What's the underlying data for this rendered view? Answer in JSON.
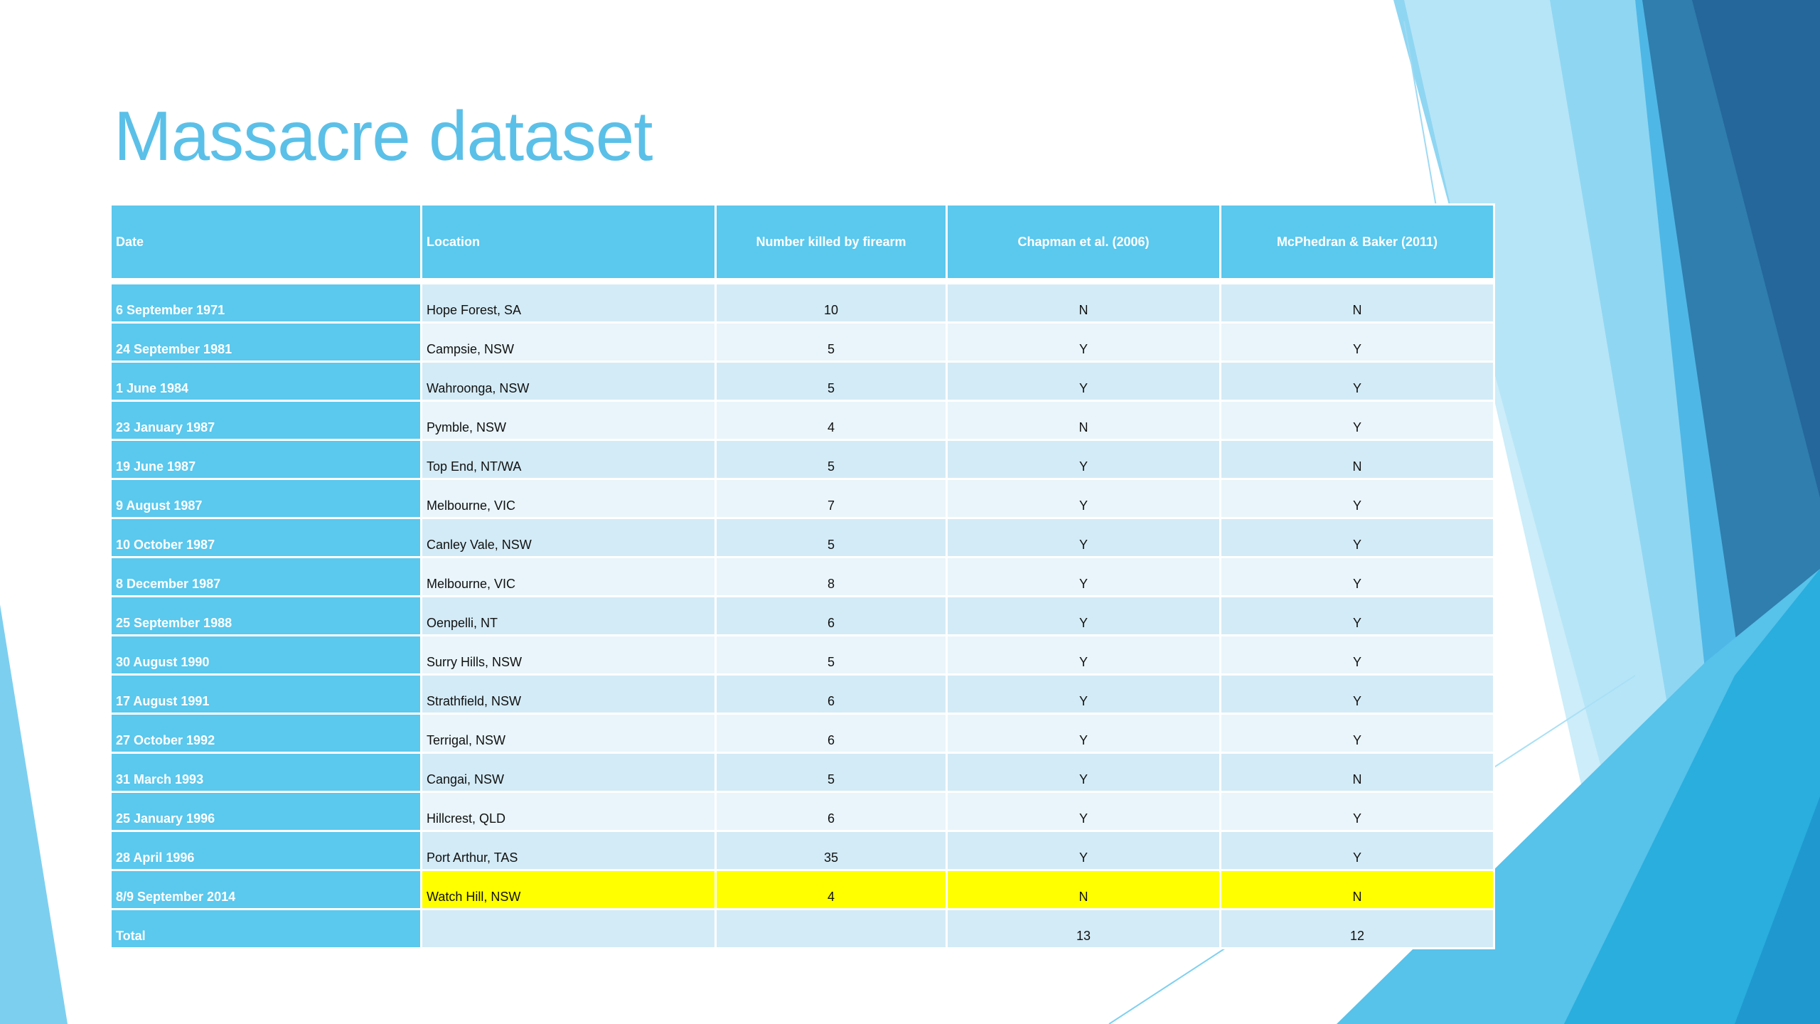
{
  "slide": {
    "title": "Massacre dataset"
  },
  "table": {
    "headers": [
      "Date",
      "Location",
      "Number killed by firearm",
      "Chapman et al. (2006)",
      "McPhedran & Baker (2011)"
    ],
    "rows": [
      {
        "date": "6 September 1971",
        "location": "Hope Forest, SA",
        "killed": "10",
        "chapman": "N",
        "mcphedran": "N",
        "highlight": false
      },
      {
        "date": "24 September 1981",
        "location": "Campsie, NSW",
        "killed": "5",
        "chapman": "Y",
        "mcphedran": "Y",
        "highlight": false
      },
      {
        "date": "1 June 1984",
        "location": "Wahroonga, NSW",
        "killed": "5",
        "chapman": "Y",
        "mcphedran": "Y",
        "highlight": false
      },
      {
        "date": "23 January 1987",
        "location": "Pymble, NSW",
        "killed": "4",
        "chapman": "N",
        "mcphedran": "Y",
        "highlight": false
      },
      {
        "date": "19 June 1987",
        "location": "Top End, NT/WA",
        "killed": "5",
        "chapman": "Y",
        "mcphedran": "N",
        "highlight": false
      },
      {
        "date": "9 August 1987",
        "location": "Melbourne, VIC",
        "killed": "7",
        "chapman": "Y",
        "mcphedran": "Y",
        "highlight": false
      },
      {
        "date": "10 October 1987",
        "location": "Canley Vale, NSW",
        "killed": "5",
        "chapman": "Y",
        "mcphedran": "Y",
        "highlight": false
      },
      {
        "date": "8 December 1987",
        "location": "Melbourne, VIC",
        "killed": "8",
        "chapman": "Y",
        "mcphedran": "Y",
        "highlight": false
      },
      {
        "date": "25 September 1988",
        "location": "Oenpelli, NT",
        "killed": "6",
        "chapman": "Y",
        "mcphedran": "Y",
        "highlight": false
      },
      {
        "date": "30 August 1990",
        "location": "Surry Hills, NSW",
        "killed": "5",
        "chapman": "Y",
        "mcphedran": "Y",
        "highlight": false
      },
      {
        "date": "17 August 1991",
        "location": "Strathfield, NSW",
        "killed": "6",
        "chapman": "Y",
        "mcphedran": "Y",
        "highlight": false
      },
      {
        "date": "27 October 1992",
        "location": "Terrigal, NSW",
        "killed": "6",
        "chapman": "Y",
        "mcphedran": "Y",
        "highlight": false
      },
      {
        "date": "31 March 1993",
        "location": "Cangai, NSW",
        "killed": "5",
        "chapman": "Y",
        "mcphedran": "N",
        "highlight": false
      },
      {
        "date": "25 January 1996",
        "location": "Hillcrest, QLD",
        "killed": "6",
        "chapman": "Y",
        "mcphedran": "Y",
        "highlight": false
      },
      {
        "date": "28 April 1996",
        "location": "Port Arthur, TAS",
        "killed": "35",
        "chapman": "Y",
        "mcphedran": "Y",
        "highlight": false
      },
      {
        "date": "8/9 September 2014",
        "location": "Watch Hill, NSW",
        "killed": "4",
        "chapman": "N",
        "mcphedran": "N",
        "highlight": true
      }
    ],
    "total": {
      "label": "Total",
      "location": "",
      "killed": "",
      "chapman": "13",
      "mcphedran": "12"
    }
  },
  "colors": {
    "accent": "#5bc8ed",
    "title": "#5bc0e8",
    "row_odd": "#d3ebf6",
    "row_even": "#e9f5fa",
    "highlight": "#ffff00"
  }
}
